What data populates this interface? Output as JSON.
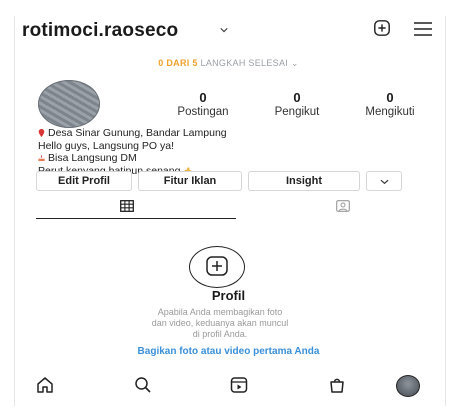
{
  "header": {
    "username": "rotimoci.raoseco",
    "steps_highlight": "0 DARI 5",
    "steps_rest": "LANGKAH SELESAI"
  },
  "icons": {
    "username_dropdown": "chevron-down-icon",
    "add": "add-post-icon",
    "menu": "hamburger-menu-icon",
    "grid_tab": "grid-icon",
    "tagged_tab": "tagged-photo-icon",
    "empty_add": "add-circle-icon",
    "nav": [
      "home-icon",
      "search-icon",
      "reels-icon",
      "shop-icon",
      "profile-avatar-icon"
    ]
  },
  "stats": [
    {
      "value": "0",
      "label": "Postingan"
    },
    {
      "value": "0",
      "label": "Pengikut"
    },
    {
      "value": "0",
      "label": "Mengikuti"
    }
  ],
  "bio": {
    "location": "Desa Sinar Gunung, Bandar Lampung",
    "line2": "Hello guys, Langsung PO ya!",
    "line3": "Bisa Langsung DM",
    "line4": "Perut kenyang hatipun senang"
  },
  "buttons": {
    "edit_profile": "Edit Profil",
    "ads": "Fitur Iklan",
    "insight": "Insight"
  },
  "empty_state": {
    "title": "Profil",
    "description": "Apabila Anda membagikan foto dan video, keduanya akan muncul di profil Anda.",
    "link": "Bagikan foto atau video pertama Anda"
  },
  "colors": {
    "accent_link": "#3a8fd8",
    "steps_highlight": "#f0a12a",
    "text_primary": "#1a1a1a",
    "muted": "#9a9a9a"
  }
}
